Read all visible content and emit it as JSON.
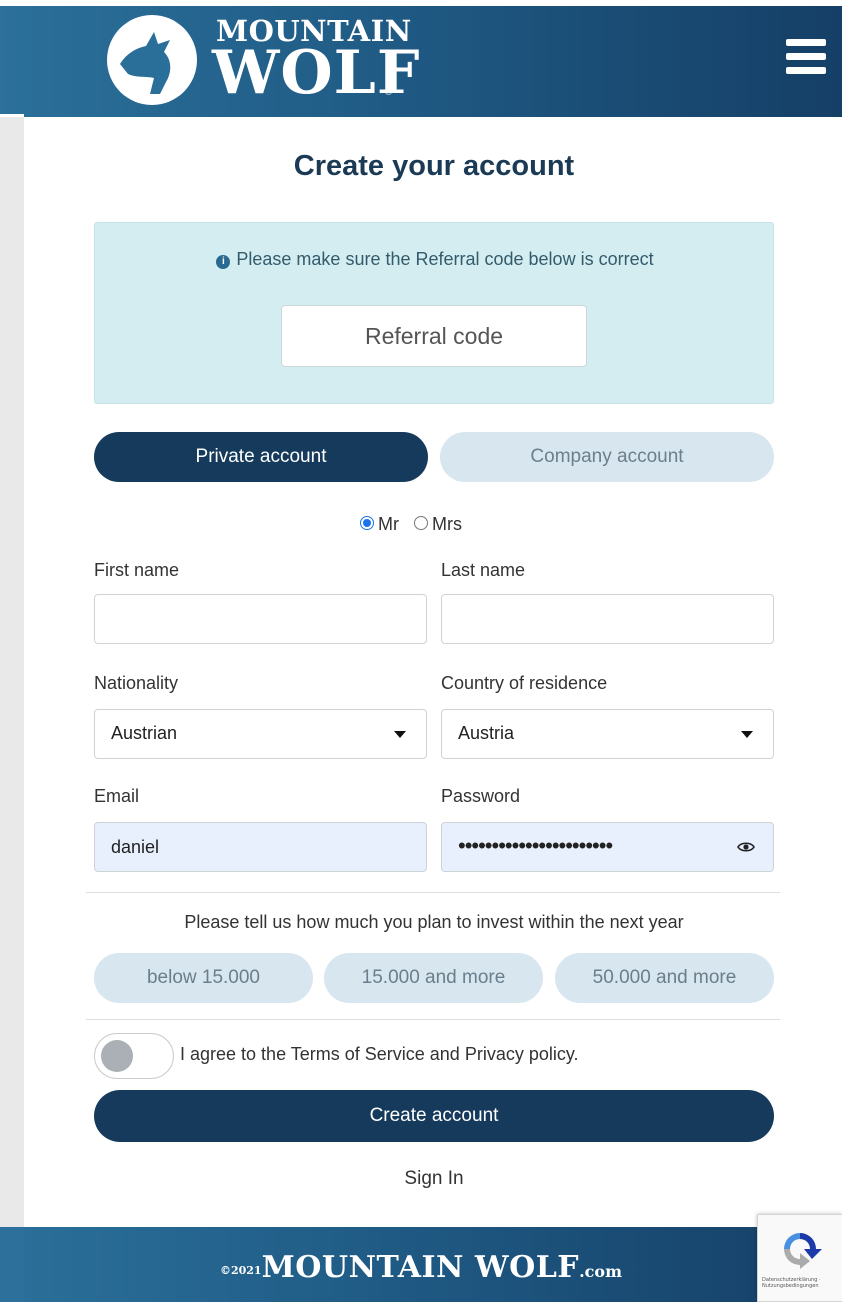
{
  "header": {
    "logo_top": "MOUNTAIN",
    "logo_bottom": "WOLF",
    "logo_reg": "®",
    "menu_icon": "hamburger-menu-icon"
  },
  "page": {
    "title": "Create your account"
  },
  "referral": {
    "info_icon": "info-icon",
    "message": "Please make sure the Referral code below is correct",
    "placeholder": "Referral code"
  },
  "account_type": {
    "private_label": "Private account",
    "company_label": "Company account",
    "selected": "private"
  },
  "salutation": {
    "options": [
      "Mr",
      "Mrs"
    ],
    "selected": "Mr"
  },
  "form": {
    "first_name_label": "First name",
    "first_name_value": "",
    "last_name_label": "Last name",
    "last_name_value": "",
    "nationality_label": "Nationality",
    "nationality_value": "Austrian",
    "residence_label": "Country of residence",
    "residence_value": "Austria",
    "email_label": "Email",
    "email_value": "daniel",
    "password_label": "Password",
    "password_mask": "•••••••••••••••••••••••"
  },
  "invest": {
    "question": "Please tell us how much you plan to invest within the next year",
    "options": [
      "below 15.000",
      "15.000 and more",
      "50.000 and more"
    ]
  },
  "agree": {
    "text": "I agree to the Terms of Service and Privacy policy.",
    "checked": false
  },
  "actions": {
    "create_label": "Create account",
    "signin_label": "Sign In"
  },
  "footer": {
    "year": "©2021",
    "brand": "MOUNTAIN WOLF",
    "suffix": ".com"
  },
  "recaptcha": {
    "text": "Datenschutzerklärung · Nutzungsbedingungen"
  },
  "colors": {
    "brand_dark": "#153a5c",
    "brand_light": "#d8e6ef",
    "info_bg": "#d3edf1",
    "autofill": "#e8f0fe"
  }
}
